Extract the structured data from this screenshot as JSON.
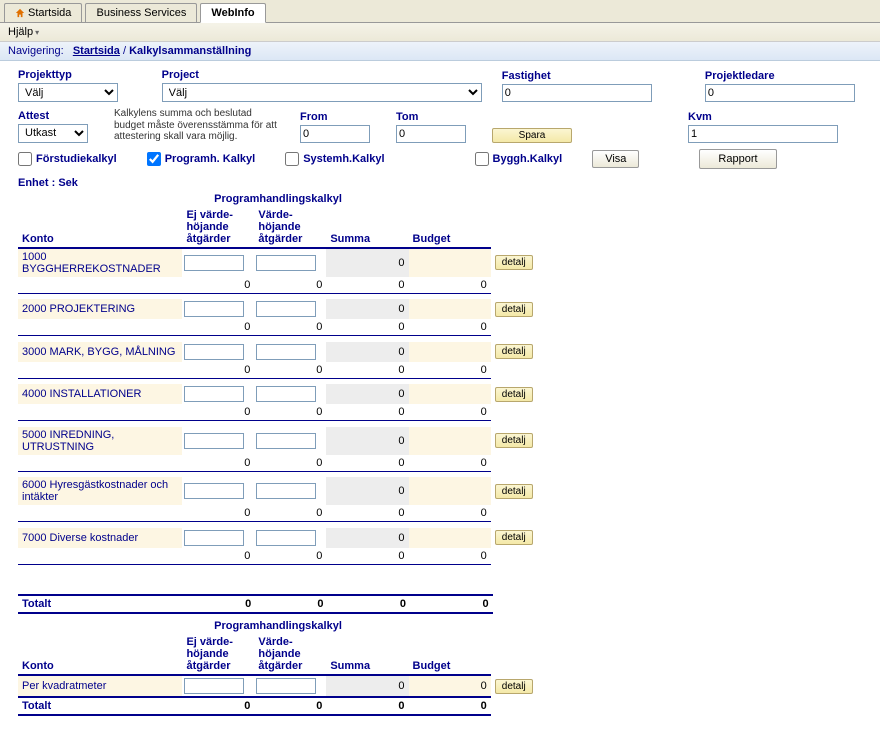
{
  "tabs": {
    "startsida": "Startsida",
    "business_services": "Business Services",
    "webinfo": "WebInfo"
  },
  "help": "Hjälp",
  "breadcrumb": {
    "label": "Navigering:",
    "startsida": "Startsida",
    "current": "Kalkylsammanställning"
  },
  "filters": {
    "projekttyp": {
      "label": "Projekttyp",
      "value": "Välj"
    },
    "project": {
      "label": "Project",
      "value": "Välj"
    },
    "fastighet": {
      "label": "Fastighet",
      "value": "0"
    },
    "projektledare": {
      "label": "Projektledare",
      "value": "0"
    },
    "attest": {
      "label": "Attest",
      "value": "Utkast"
    },
    "hint": "Kalkylens summa och beslutad budget måste överensstämma för att attestering skall vara möjlig.",
    "from": {
      "label": "From",
      "value": "0"
    },
    "tom": {
      "label": "Tom",
      "value": "0"
    },
    "kvm": {
      "label": "Kvm",
      "value": "1"
    },
    "spara": "Spara",
    "visa": "Visa",
    "rapport": "Rapport"
  },
  "checks": {
    "forstudie": "Förstudiekalkyl",
    "programh": "Programh. Kalkyl",
    "systemh": "Systemh.Kalkyl",
    "byggh": "Byggh.Kalkyl"
  },
  "unit": "Enhet : Sek",
  "section_title": "Programhandlingskalkyl",
  "headers": {
    "konto": "Konto",
    "ej": "Ej värde-höjande åtgärder",
    "varde": "Värde-höjande åtgärder",
    "summa": "Summa",
    "budget": "Budget"
  },
  "rows": [
    {
      "konto": "1000 BYGGHERREKOSTNADER",
      "ej": "",
      "varde": "",
      "summa": "0",
      "budget": "",
      "sub_ej": "0",
      "sub_varde": "0",
      "sub_summa": "0",
      "sub_budget": "0"
    },
    {
      "konto": "2000 PROJEKTERING",
      "ej": "",
      "varde": "",
      "summa": "0",
      "budget": "",
      "sub_ej": "0",
      "sub_varde": "0",
      "sub_summa": "0",
      "sub_budget": "0"
    },
    {
      "konto": "3000 MARK, BYGG, MÅLNING",
      "ej": "",
      "varde": "",
      "summa": "0",
      "budget": "",
      "sub_ej": "0",
      "sub_varde": "0",
      "sub_summa": "0",
      "sub_budget": "0"
    },
    {
      "konto": "4000 INSTALLATIONER",
      "ej": "",
      "varde": "",
      "summa": "0",
      "budget": "",
      "sub_ej": "0",
      "sub_varde": "0",
      "sub_summa": "0",
      "sub_budget": "0"
    },
    {
      "konto": "5000 INREDNING, UTRUSTNING",
      "ej": "",
      "varde": "",
      "summa": "0",
      "budget": "",
      "sub_ej": "0",
      "sub_varde": "0",
      "sub_summa": "0",
      "sub_budget": "0"
    },
    {
      "konto": "6000 Hyresgästkostnader och intäkter",
      "ej": "",
      "varde": "",
      "summa": "0",
      "budget": "",
      "sub_ej": "0",
      "sub_varde": "0",
      "sub_summa": "0",
      "sub_budget": "0"
    },
    {
      "konto": "7000 Diverse kostnader",
      "ej": "",
      "varde": "",
      "summa": "0",
      "budget": "",
      "sub_ej": "0",
      "sub_varde": "0",
      "sub_summa": "0",
      "sub_budget": "0"
    }
  ],
  "totals": {
    "label": "Totalt",
    "ej": "0",
    "varde": "0",
    "summa": "0",
    "budget": "0"
  },
  "perkvm": {
    "label": "Per kvadratmeter",
    "ej": "",
    "varde": "",
    "summa": "0",
    "budget": "0"
  },
  "totals2": {
    "label": "Totalt",
    "ej": "0",
    "varde": "0",
    "summa": "0",
    "budget": "0"
  },
  "detail": "detalj"
}
